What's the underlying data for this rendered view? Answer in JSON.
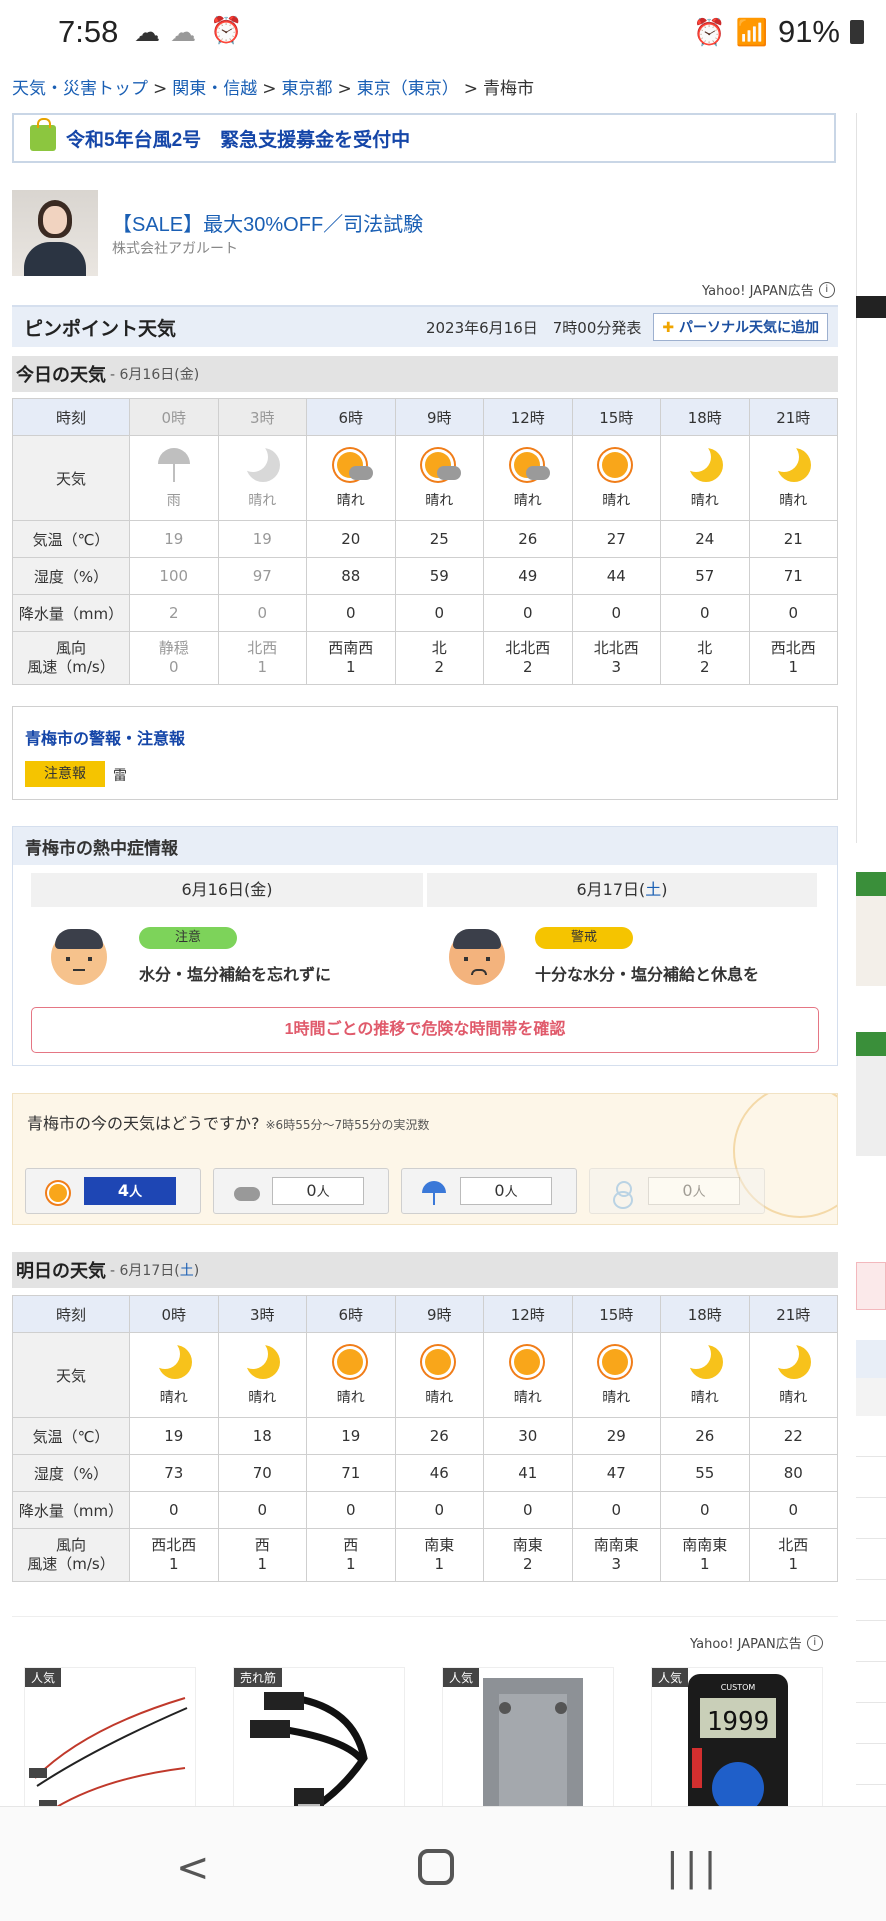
{
  "status": {
    "time": "7:58",
    "battery": "91%"
  },
  "breadcrumb": [
    "天気・災害トップ",
    "関東・信越",
    "東京都",
    "東京（東京）",
    "青梅市"
  ],
  "banner": {
    "text": "令和5年台風2号　緊急支援募金を受付中"
  },
  "ad_top": {
    "title": "【SALE】最大30%OFF／司法試験",
    "advertiser": "株式会社アガルート",
    "ad_label": "Yahoo! JAPAN広告"
  },
  "pinpoint": {
    "title": "ピンポイント天気",
    "issued": "2023年6月16日　7時00分発表",
    "add_button": "パーソナル天気に追加"
  },
  "row_labels": {
    "hour": "時刻",
    "weather": "天気",
    "temp": "気温（℃）",
    "humidity": "湿度（%）",
    "precip": "降水量（mm）",
    "wind_dir": "風向",
    "wind_speed": "風速（m/s）"
  },
  "today": {
    "title": "今日の天気",
    "date_prefix": " - 6月16日(",
    "date_dow": "金",
    "date_suffix": ")",
    "hours": [
      "0時",
      "3時",
      "6時",
      "9時",
      "12時",
      "15時",
      "18時",
      "21時"
    ],
    "weather": [
      "雨",
      "晴れ",
      "晴れ",
      "晴れ",
      "晴れ",
      "晴れ",
      "晴れ",
      "晴れ"
    ],
    "icons": [
      "umbrella",
      "moon",
      "sun-cloud",
      "sun-cloud",
      "sun-cloud",
      "sun",
      "moon",
      "moon"
    ],
    "temp": [
      "19",
      "19",
      "20",
      "25",
      "26",
      "27",
      "24",
      "21"
    ],
    "humidity": [
      "100",
      "97",
      "88",
      "59",
      "49",
      "44",
      "57",
      "71"
    ],
    "precip": [
      "2",
      "0",
      "0",
      "0",
      "0",
      "0",
      "0",
      "0"
    ],
    "wind_dir": [
      "静穏",
      "北西",
      "西南西",
      "北",
      "北北西",
      "北北西",
      "北",
      "西北西"
    ],
    "wind_speed": [
      "0",
      "1",
      "1",
      "2",
      "2",
      "3",
      "2",
      "1"
    ]
  },
  "alerts": {
    "title": "青梅市の警報・注意報",
    "badge": "注意報",
    "item": "雷"
  },
  "heatstroke": {
    "title": "青梅市の熱中症情報",
    "days": [
      {
        "date_prefix": "6月16日(",
        "dow": "金",
        "suffix": ")",
        "level": "注意",
        "message": "水分・塩分補給を忘れずに",
        "level_color": "#7dd35a"
      },
      {
        "date_prefix": "6月17日(",
        "dow": "土",
        "suffix": ")",
        "level": "警戒",
        "message": "十分な水分・塩分補給と休息を",
        "level_color": "#f5c400"
      }
    ],
    "link": "1時間ごとの推移で危険な時間帯を確認"
  },
  "vote": {
    "question": "青梅市の今の天気はどうですか?",
    "note": "※6時55分〜7時55分の実況数",
    "options": [
      {
        "icon": "sun-icon",
        "count": "4",
        "unit": "人"
      },
      {
        "icon": "cloud-icon",
        "count": "0",
        "unit": "人"
      },
      {
        "icon": "umbrella-icon",
        "count": "0",
        "unit": "人"
      },
      {
        "icon": "snowman-icon",
        "count": "0",
        "unit": "人"
      }
    ]
  },
  "tomorrow": {
    "title": "明日の天気",
    "date_prefix": " - 6月17日(",
    "date_dow": "土",
    "date_suffix": ")",
    "hours": [
      "0時",
      "3時",
      "6時",
      "9時",
      "12時",
      "15時",
      "18時",
      "21時"
    ],
    "weather": [
      "晴れ",
      "晴れ",
      "晴れ",
      "晴れ",
      "晴れ",
      "晴れ",
      "晴れ",
      "晴れ"
    ],
    "icons": [
      "moon",
      "moon",
      "sun",
      "sun",
      "sun",
      "sun",
      "moon",
      "moon"
    ],
    "temp": [
      "19",
      "18",
      "19",
      "26",
      "30",
      "29",
      "26",
      "22"
    ],
    "humidity": [
      "73",
      "70",
      "71",
      "46",
      "41",
      "47",
      "55",
      "80"
    ],
    "precip": [
      "0",
      "0",
      "0",
      "0",
      "0",
      "0",
      "0",
      "0"
    ],
    "wind_dir": [
      "西北西",
      "西",
      "西",
      "南東",
      "南東",
      "南南東",
      "南南東",
      "北西"
    ],
    "wind_speed": [
      "1",
      "1",
      "1",
      "1",
      "2",
      "3",
      "1",
      "1"
    ]
  },
  "ads_bottom": {
    "ad_label": "Yahoo! JAPAN広告",
    "tags": [
      "人気",
      "売れ筋",
      "人気",
      "人気"
    ],
    "meter_display": "1999",
    "meter_brand": "CUSTOM"
  }
}
